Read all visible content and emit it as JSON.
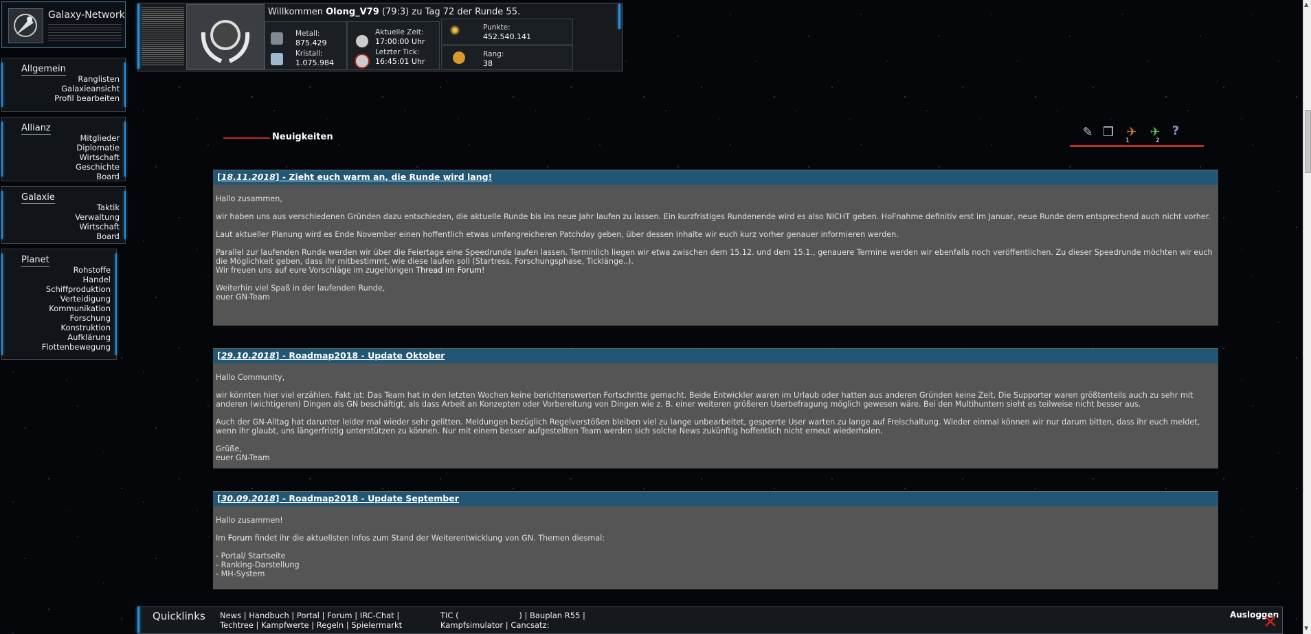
{
  "brand": {
    "title": "Galaxy-Network"
  },
  "nav": [
    {
      "title": "Allgemein",
      "items": [
        "Ranglisten",
        "Galaxieansicht",
        "Profil bearbeiten"
      ]
    },
    {
      "title": "Allianz",
      "items": [
        "Mitglieder",
        "Diplomatie",
        "Wirtschaft",
        "Geschichte",
        "Board"
      ]
    },
    {
      "title": "Galaxie",
      "items": [
        "Taktik",
        "Verwaltung",
        "Wirtschaft",
        "Board"
      ]
    },
    {
      "title": "Planet",
      "items": [
        "Rohstoffe",
        "Handel",
        "Schiffproduktion",
        "Verteidigung",
        "Kommunikation",
        "Forschung",
        "Konstruktion",
        "Aufklärung",
        "Flottenbewegung"
      ]
    }
  ],
  "header": {
    "welcome_prefix": "Willkommen ",
    "username": "Olong_V79",
    "welcome_suffix": " (79:3) zu Tag 72 der Runde 55.",
    "metall_label": "Metall:",
    "metall_value": "875.429",
    "kristall_label": "Kristall:",
    "kristall_value": "1.075.984",
    "zeit_label": "Aktuelle Zeit:",
    "zeit_value": "17:00:00 Uhr",
    "tick_label": "Letzter Tick:",
    "tick_value": "16:45:01 Uhr",
    "punkte_label": "Punkte:",
    "punkte_value": "452.540.141",
    "rang_label": "Rang:",
    "rang_value": "38"
  },
  "section_title": "Neuigkeiten",
  "toolbar": {
    "badge1": "1",
    "badge2": "2",
    "help": "?"
  },
  "news": [
    {
      "date": "18.11.2018",
      "title": " - Zieht euch warm an, die Runde wird lang!",
      "greeting": "Hallo zusammen,",
      "p1": "wir haben uns aus verschiedenen Gründen dazu entschieden, die aktuelle Runde bis ins neue Jahr laufen zu lassen. Ein kurzfristiges Rundenende wird es also NICHT geben. HoFnahme definitiv erst im Januar, neue Runde dem entsprechend auch nicht vorher.",
      "p2": "Laut aktueller Planung wird es Ende November einen hoffentlich etwas umfangreicheren Patchday geben, über dessen Inhalte wir euch kurz vorher genauer informieren werden.",
      "p3": "Parallel zur laufenden Runde werden wir über die Feiertage eine Speedrunde laufen lassen. Terminlich liegen wir etwa zwischen dem 15.12. und dem 15.1., genauere Termine werden wir ebenfalls noch veröffentlichen. Zu dieser Speedrunde möchten wir euch die Möglichkeit geben, dass ihr mitbestimmt, wie diese laufen soll (Startress, Forschungsphase, Ticklänge..).",
      "p3b_prefix": "Wir freuen uns auf eure Vorschläge im zugehörigen ",
      "p3b_link": "Thread im Forum",
      "p3b_suffix": "!",
      "closing1": "Weiterhin viel Spaß in der laufenden Runde,",
      "closing2": "euer GN-Team"
    },
    {
      "date": "29.10.2018",
      "title": " - Roadmap2018 - Update Oktober",
      "greeting": "Hallo Community,",
      "p1": "wir könnten hier viel erzählen. Fakt ist: Das Team hat in den letzten Wochen keine berichtenswerten Fortschritte gemacht. Beide Entwickler waren im Urlaub oder hatten aus anderen Gründen keine Zeit. Die Supporter waren größtenteils auch zu sehr mit anderen (wichtigeren) Dingen als GN beschäftigt, als dass Arbeit an Konzepten oder Vorbereitung von Dingen wie z. B. einer weiteren größeren Userbefragung möglich gewesen wäre. Bei den Multihuntern sieht es teilweise nicht besser aus.",
      "p2": "Auch der GN-Alltag hat darunter leider mal wieder sehr gelitten. Meldungen bezüglich Regelverstößen bleiben viel zu lange unbearbeitet, gesperrte User warten zu lange auf Freischaltung. Wieder einmal können wir nur darum bitten, dass ihr euch meldet, wenn ihr glaubt, uns längerfristig unterstützen zu können. Nur mit einem besser aufgestellten Team werden sich solche News zukünftig hoffentlich nicht erneut wiederholen.",
      "closing1": "Grüße,",
      "closing2": "euer GN-Team"
    },
    {
      "date": "30.09.2018",
      "title": " - Roadmap2018 - Update September",
      "greeting": "Hallo zusammen!",
      "p1_prefix": "Im ",
      "p1_link": "Forum",
      "p1_suffix": " findet ihr die aktuellsten Infos zum Stand der Weiterentwicklung von GN. Themen diesmal:",
      "list": [
        "- Portal/ Startseite",
        "- Ranking-Darstellung",
        "- MH-System"
      ]
    }
  ],
  "footer": {
    "title": "Quicklinks",
    "row1": "News | Handbuch | Portal | Forum | IRC-Chat |",
    "row2": "Techtree | Kampfwerte | Regeln | Spielermarkt",
    "row1b": "TIC (                        ) | Bauplan R55 |",
    "row2b": "Kampfsimulator | Cancsatz:",
    "logout": "Ausloggen"
  },
  "colors": {
    "accent_blue": "#2e8fd6",
    "news_header": "#215774",
    "news_body": "#555555",
    "red_line": "#c42a2a"
  }
}
